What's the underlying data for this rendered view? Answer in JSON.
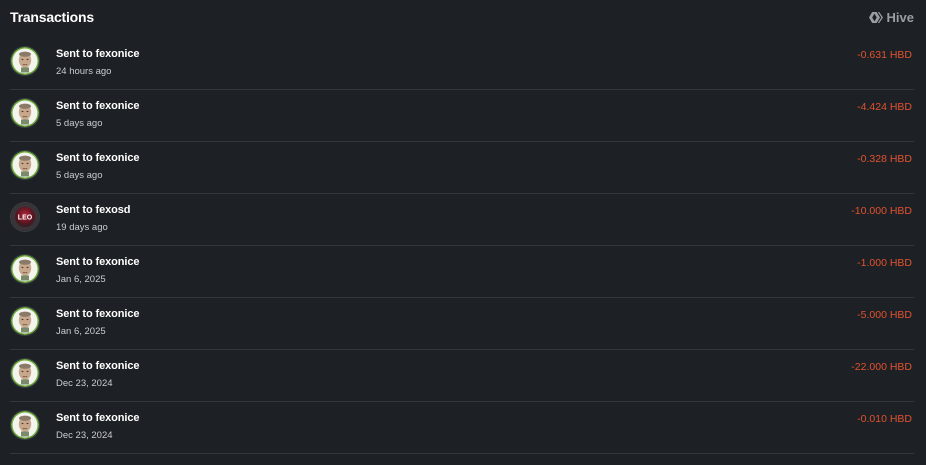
{
  "header": {
    "title": "Transactions",
    "brand_label": "Hive",
    "brand_icon": "hive-logo-icon"
  },
  "colors": {
    "background": "#1d2024",
    "negative_amount": "#e1532f",
    "divider": "#33373d"
  },
  "transactions": [
    {
      "label": "Sent to fexonice",
      "time": "24 hours ago",
      "amount": "-0.631 HBD",
      "avatar": "fexonice"
    },
    {
      "label": "Sent to fexonice",
      "time": "5 days ago",
      "amount": "-4.424 HBD",
      "avatar": "fexonice"
    },
    {
      "label": "Sent to fexonice",
      "time": "5 days ago",
      "amount": "-0.328 HBD",
      "avatar": "fexonice"
    },
    {
      "label": "Sent to fexosd",
      "time": "19 days ago",
      "amount": "-10.000 HBD",
      "avatar": "leo"
    },
    {
      "label": "Sent to fexonice",
      "time": "Jan 6, 2025",
      "amount": "-1.000 HBD",
      "avatar": "fexonice"
    },
    {
      "label": "Sent to fexonice",
      "time": "Jan 6, 2025",
      "amount": "-5.000 HBD",
      "avatar": "fexonice"
    },
    {
      "label": "Sent to fexonice",
      "time": "Dec 23, 2024",
      "amount": "-22.000 HBD",
      "avatar": "fexonice"
    },
    {
      "label": "Sent to fexonice",
      "time": "Dec 23, 2024",
      "amount": "-0.010 HBD",
      "avatar": "fexonice"
    }
  ],
  "avatar_texts": {
    "leo": "LEO"
  }
}
